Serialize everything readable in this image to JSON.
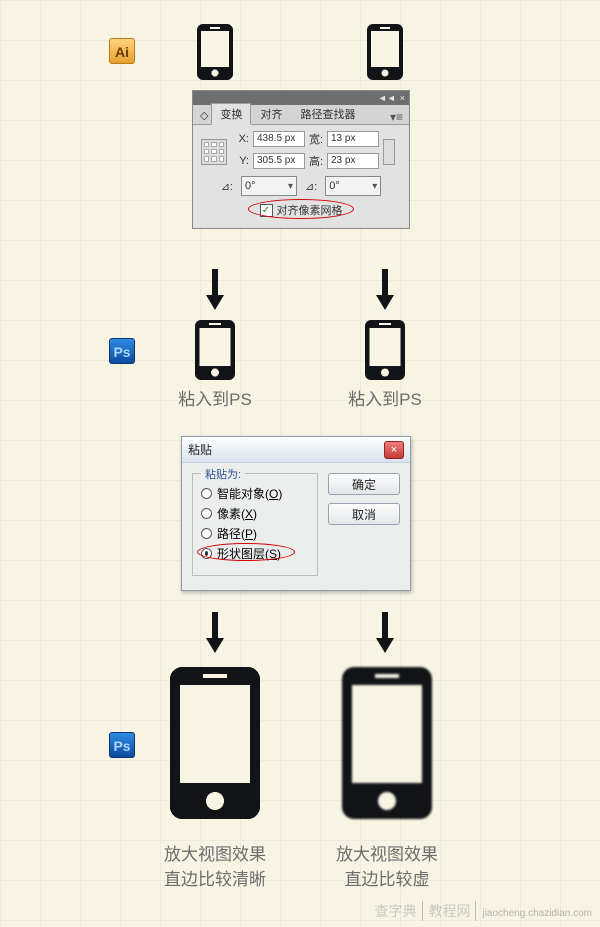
{
  "badges": {
    "ai": "Ai",
    "ps": "Ps"
  },
  "captions": {
    "paste_ps_left": "粘入到PS",
    "paste_ps_right": "粘入到PS",
    "zoom_left_1": "放大视图效果",
    "zoom_left_2": "直边比较清晰",
    "zoom_right_1": "放大视图效果",
    "zoom_right_2": "直边比较虚"
  },
  "transform_panel": {
    "tabs": {
      "transform": "变换",
      "align": "对齐",
      "pathfinder": "路径查找器"
    },
    "labels": {
      "x": "X:",
      "y": "Y:",
      "w": "宽:",
      "h": "高:",
      "angle": "⊿",
      "shear": "⊿"
    },
    "values": {
      "x": "438.5 px",
      "y": "305.5 px",
      "w": "13 px",
      "h": "23 px",
      "angle": "0°",
      "shear": "0°"
    },
    "align_pixel_grid": "对齐像素网格",
    "checked": true
  },
  "paste_dialog": {
    "title": "粘贴",
    "legend": "粘贴为:",
    "options": {
      "smart_object": {
        "label": "智能对象(",
        "key": "O",
        "tail": ")"
      },
      "pixels": {
        "label": "像素(",
        "key": "X",
        "tail": ")"
      },
      "path": {
        "label": "路径(",
        "key": "P",
        "tail": ")"
      },
      "shape_layer": {
        "label": "形状图层(",
        "key": "S",
        "tail": ")"
      }
    },
    "selected": "shape_layer",
    "buttons": {
      "ok": "确定",
      "cancel": "取消"
    }
  },
  "watermark": {
    "site": "查字典",
    "section": "教程网",
    "domain": "jiaocheng.chazidian.com"
  }
}
